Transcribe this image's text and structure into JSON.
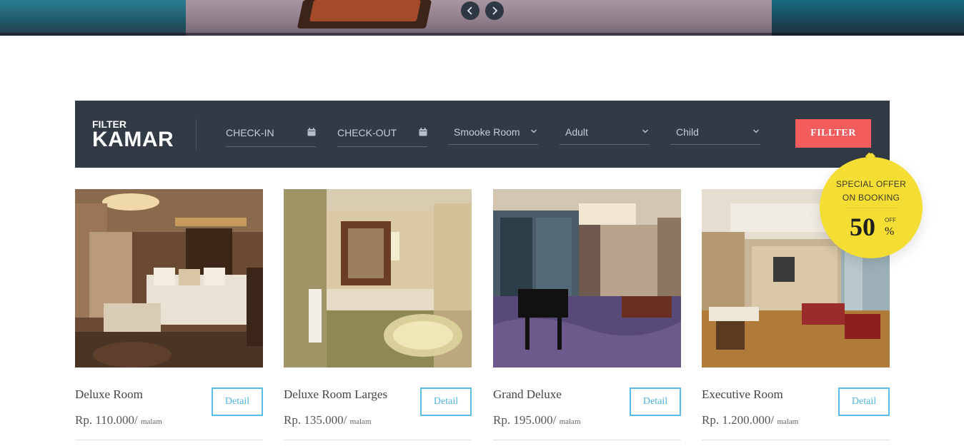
{
  "hero": {
    "prev_icon": "chevron-left-icon",
    "next_icon": "chevron-right-icon"
  },
  "filter": {
    "title_small": "FILTER",
    "title_big": "KAMAR",
    "checkin_placeholder": "CHECK-IN",
    "checkout_placeholder": "CHECK-OUT",
    "smoke_selected": "Smooke Room",
    "adult_selected": "Adult",
    "child_selected": "Child",
    "button_label": "FILLTER",
    "calendar_icon": "calendar-icon",
    "dropdown_icon": "chevron-down-icon",
    "bar_color": "#323a46",
    "button_color": "#f25c5c"
  },
  "offer": {
    "line1": "SPECIAL OFFER",
    "line2": "ON BOOKING",
    "percent": "50",
    "off": "OFF",
    "symbol": "%",
    "badge_color": "#f5de33"
  },
  "rooms": [
    {
      "name": "Deluxe Room",
      "price": "Rp. 110.000/",
      "unit": "malam",
      "button": "Detail"
    },
    {
      "name": "Deluxe Room Larges",
      "price": "Rp. 135.000/",
      "unit": "malam",
      "button": "Detail"
    },
    {
      "name": "Grand Deluxe",
      "price": "Rp. 195.000/",
      "unit": "malam",
      "button": "Detail"
    },
    {
      "name": "Executive Room",
      "price": "Rp. 1.200.000/",
      "unit": "malam",
      "button": "Detail"
    }
  ],
  "accent_color": "#5bbde6"
}
